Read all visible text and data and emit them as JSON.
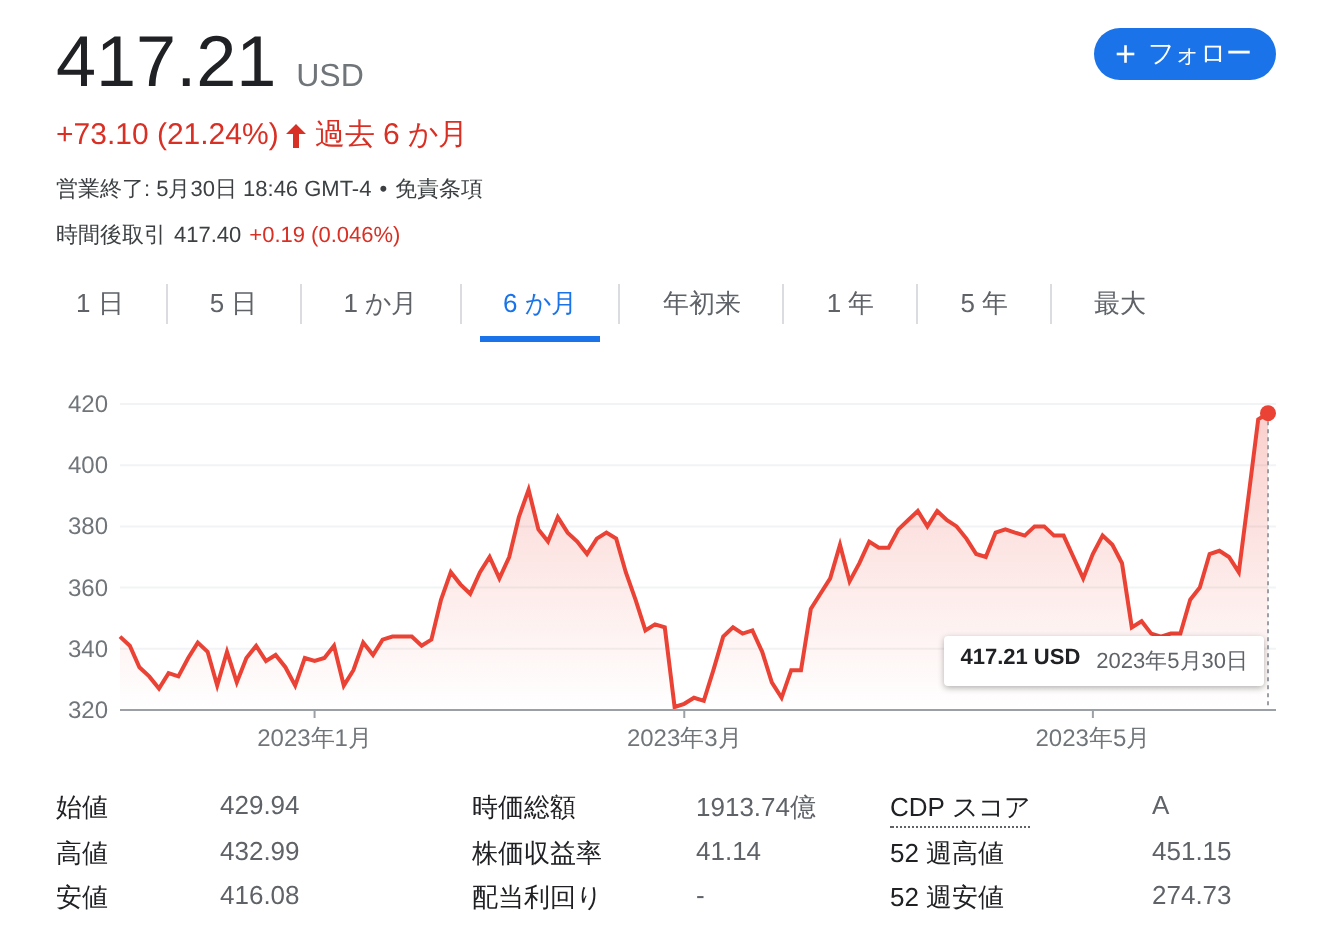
{
  "quote": {
    "price": "417.21",
    "currency": "USD",
    "change": "+73.10 (21.24%)",
    "period": "過去 6 か月"
  },
  "follow_button": {
    "icon": "+",
    "label": "フォロー"
  },
  "status": {
    "text": "営業終了: 5月30日 18:46 GMT-4",
    "separator": "•",
    "link": "免責条項"
  },
  "after_hours": {
    "label": "時間後取引",
    "price": "417.40",
    "change": "+0.19 (0.046%)"
  },
  "ranges": [
    {
      "label": "1 日",
      "selected": false
    },
    {
      "label": "5 日",
      "selected": false
    },
    {
      "label": "1 か月",
      "selected": false
    },
    {
      "label": "6 か月",
      "selected": true
    },
    {
      "label": "年初来",
      "selected": false
    },
    {
      "label": "1 年",
      "selected": false
    },
    {
      "label": "5 年",
      "selected": false
    },
    {
      "label": "最大",
      "selected": false
    }
  ],
  "chart": {
    "chart_data": {
      "type": "area",
      "grid": true,
      "ylim": [
        320,
        420
      ],
      "yticks": [
        320,
        340,
        360,
        380,
        400,
        420
      ],
      "categories": [
        null,
        null,
        null,
        null,
        null,
        null,
        null,
        null,
        null,
        null,
        null,
        null,
        null,
        null,
        null,
        null,
        null,
        null,
        null,
        null,
        "2023年1月",
        null,
        null,
        null,
        null,
        null,
        null,
        null,
        null,
        null,
        null,
        null,
        null,
        null,
        null,
        null,
        null,
        null,
        null,
        null,
        null,
        null,
        null,
        null,
        null,
        null,
        null,
        null,
        null,
        null,
        null,
        null,
        null,
        null,
        null,
        null,
        null,
        null,
        "2023年3月",
        null,
        null,
        null,
        null,
        null,
        null,
        null,
        null,
        null,
        null,
        null,
        null,
        null,
        null,
        null,
        null,
        null,
        null,
        null,
        null,
        null,
        null,
        null,
        null,
        null,
        null,
        null,
        null,
        null,
        null,
        null,
        null,
        null,
        null,
        null,
        null,
        null,
        null,
        null,
        null,
        null,
        "2023年5月",
        null,
        null,
        null,
        null,
        null,
        null,
        null,
        null,
        null,
        null,
        null,
        null,
        null,
        null,
        null,
        null,
        null,
        null
      ],
      "series": [
        {
          "color": "#ea4335",
          "values": [
            344,
            341,
            334,
            331,
            327,
            332,
            331,
            337,
            342,
            339,
            328,
            339,
            329,
            337,
            341,
            336,
            338,
            334,
            328,
            337,
            336,
            337,
            341,
            328,
            333,
            342,
            338,
            343,
            344,
            344,
            344,
            341,
            343,
            356,
            365,
            361,
            358,
            365,
            370,
            363,
            370,
            383,
            392,
            379,
            375,
            383,
            378,
            375,
            371,
            376,
            378,
            376,
            365,
            356,
            346,
            348,
            347,
            321,
            322,
            324,
            323,
            333,
            344,
            347,
            345,
            346,
            339,
            329,
            324,
            333,
            333,
            353,
            358,
            363,
            374,
            362,
            368,
            375,
            373,
            373,
            379,
            382,
            385,
            380,
            385,
            382,
            380,
            376,
            371,
            370,
            378,
            379,
            378,
            377,
            380,
            380,
            377,
            377,
            370,
            363,
            371,
            377,
            374,
            368,
            347,
            349,
            345,
            344,
            345,
            345,
            356,
            360,
            371,
            372,
            370,
            365,
            390,
            415,
            417
          ]
        }
      ]
    },
    "tooltip": {
      "price": "417.21 USD",
      "date": "2023年5月30日"
    }
  },
  "stats": [
    {
      "label": "始値",
      "value": "429.94",
      "kind": "plain"
    },
    {
      "label": "高値",
      "value": "432.99",
      "kind": "plain"
    },
    {
      "label": "安値",
      "value": "416.08",
      "kind": "plain"
    },
    {
      "label": "時価総額",
      "value": "1913.74億",
      "kind": "plain"
    },
    {
      "label": "株価収益率",
      "value": "41.14",
      "kind": "plain"
    },
    {
      "label": "配当利回り",
      "value": "-",
      "kind": "plain"
    },
    {
      "label": "CDP スコア",
      "value": "A",
      "kind": "dotted"
    },
    {
      "label": "52 週高値",
      "value": "451.15",
      "kind": "plain"
    },
    {
      "label": "52 週安値",
      "value": "274.73",
      "kind": "plain"
    }
  ]
}
